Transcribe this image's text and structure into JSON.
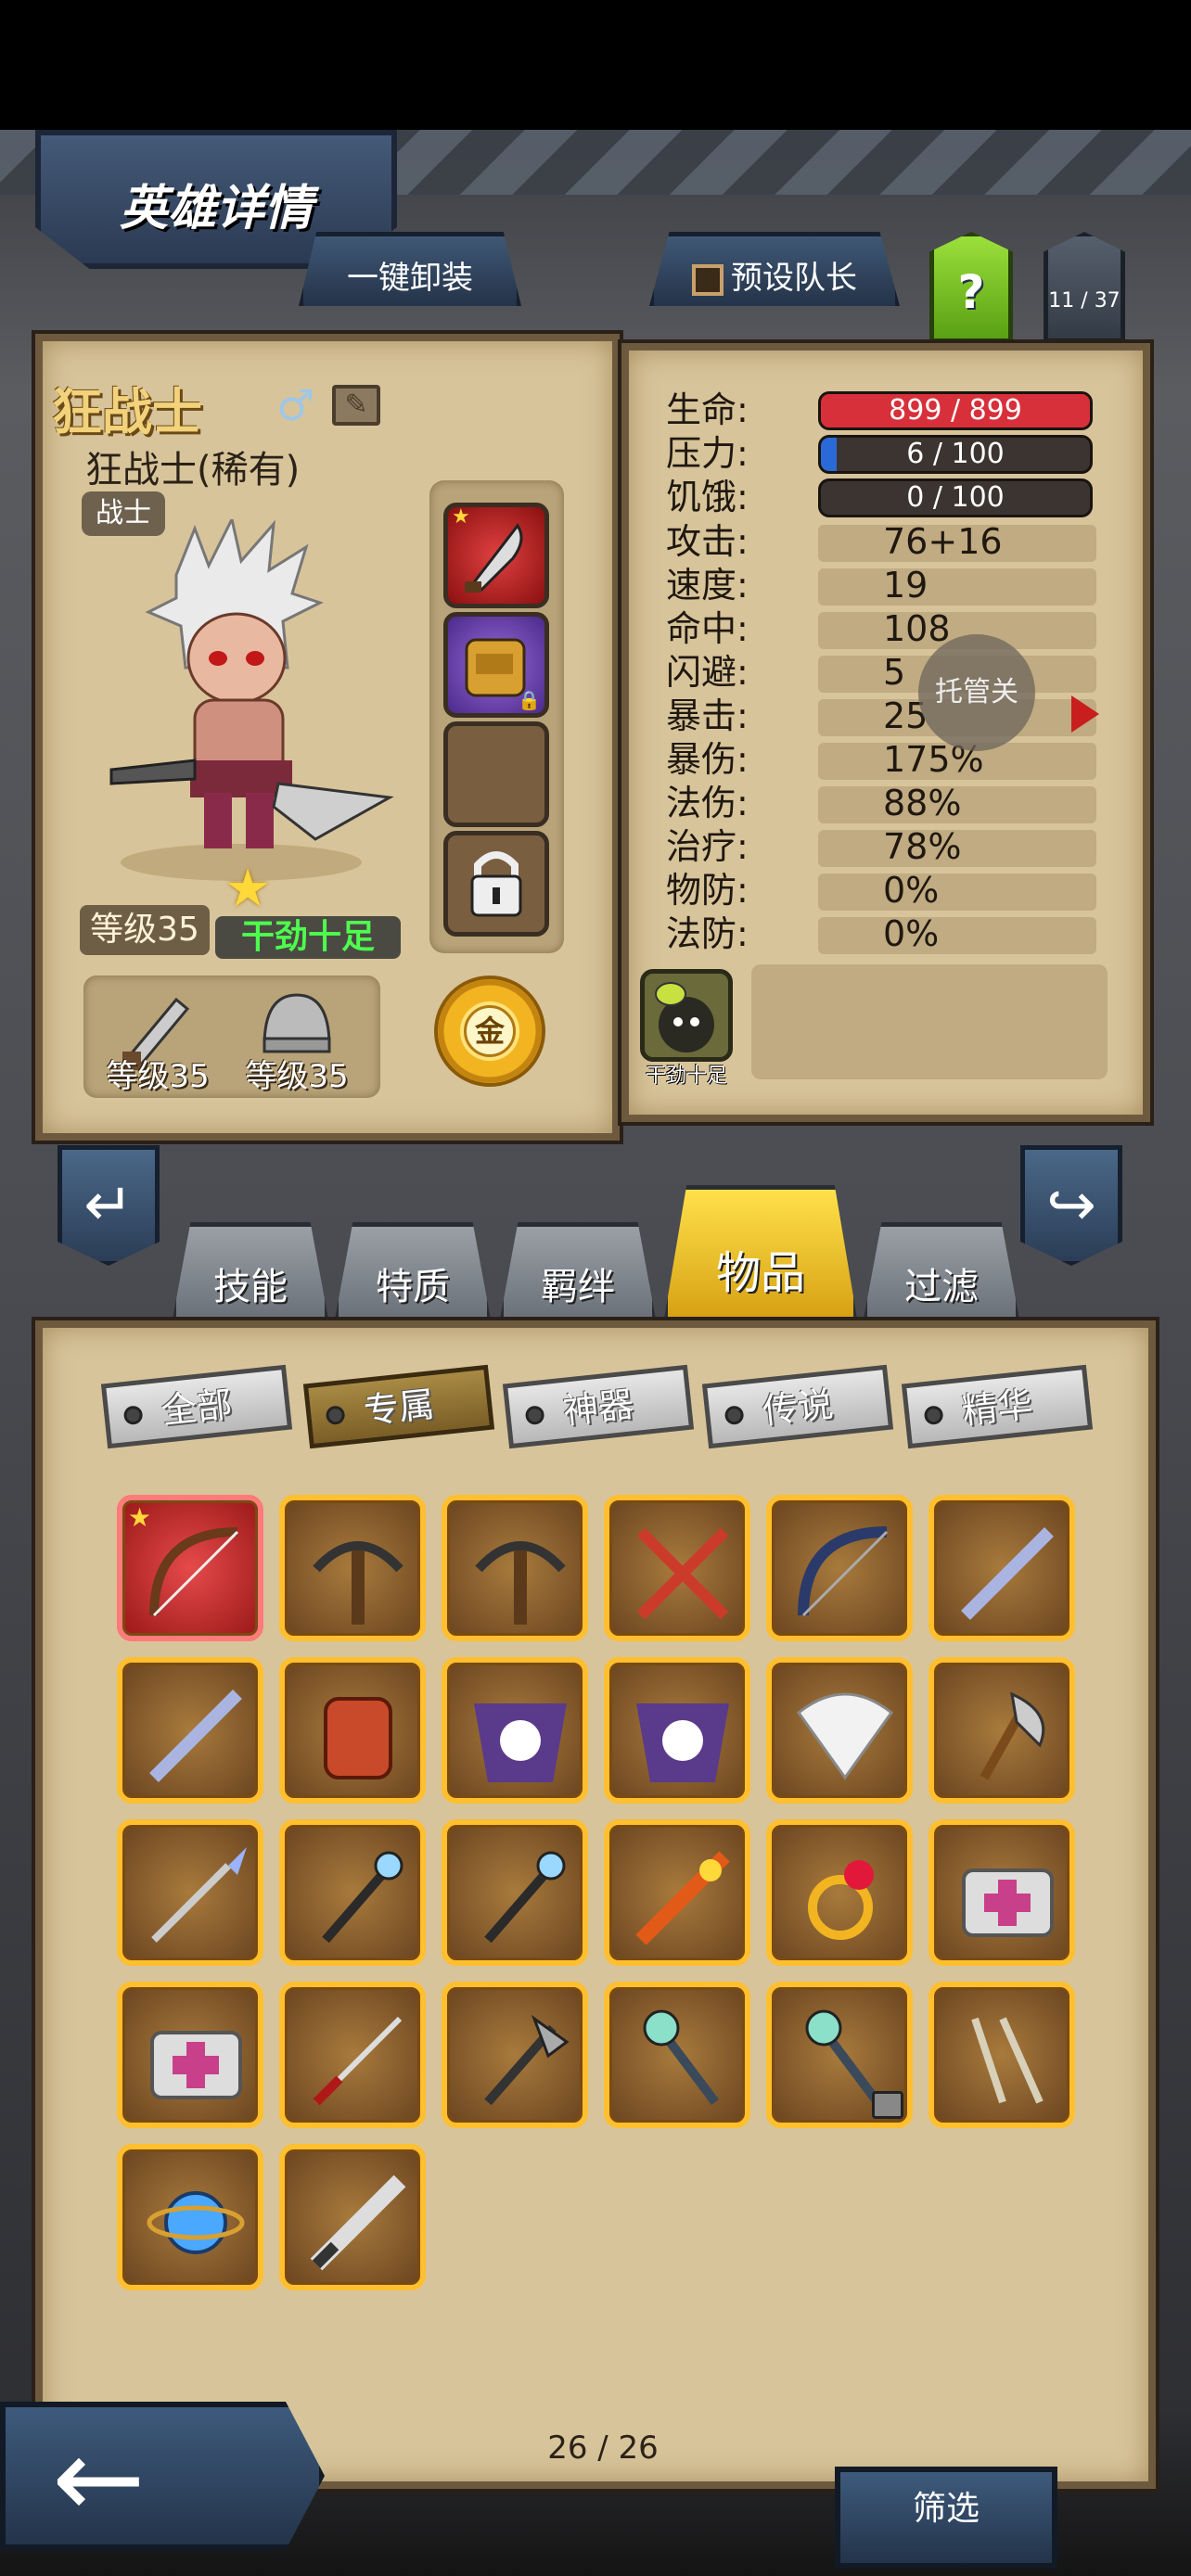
{
  "screen": {
    "title": "英雄详情"
  },
  "top_buttons": {
    "unequip_all": "一键卸装",
    "preset_leader": "预设队长",
    "help": "?",
    "hero_count": "11 / 37"
  },
  "hero": {
    "name": "狂战士",
    "subtitle": "狂战士(稀有)",
    "class": "战士",
    "level": "等级35",
    "trait": "干劲十足",
    "weapon_level": "等级35",
    "armor_level": "等级35",
    "currency": "金"
  },
  "stats": {
    "hp": {
      "label": "生命:",
      "value": "899 / 899",
      "fill": 1.0,
      "color": "#d7303a"
    },
    "stress": {
      "label": "压力:",
      "value": "6 / 100",
      "fill": 0.06,
      "color": "#2a6ad8"
    },
    "hunger": {
      "label": "饥饿:",
      "value": "0 / 100",
      "fill": 0.0,
      "color": "#888888"
    },
    "rows": [
      {
        "label": "攻击:",
        "value": "76+16"
      },
      {
        "label": "速度:",
        "value": "19"
      },
      {
        "label": "命中:",
        "value": "108"
      },
      {
        "label": "闪避:",
        "value": "5"
      },
      {
        "label": "暴击:",
        "value": "25"
      },
      {
        "label": "暴伤:",
        "value": "175%"
      },
      {
        "label": "法伤:",
        "value": "88%"
      },
      {
        "label": "治疗:",
        "value": "78%"
      },
      {
        "label": "物防:",
        "value": "0%"
      },
      {
        "label": "法防:",
        "value": "0%"
      }
    ],
    "auto_toggle": "托管关",
    "trait_slot_label": "干劲十足"
  },
  "tabs": [
    "技能",
    "特质",
    "羁绊",
    "物品",
    "过滤"
  ],
  "active_tab": "物品",
  "filters": [
    "全部",
    "专属",
    "神器",
    "传说",
    "精华"
  ],
  "active_filter": "专属",
  "items": [
    "bow",
    "crossbow",
    "crossbow",
    "twin-daggers",
    "dark-bow",
    "flute",
    "flute",
    "armor",
    "skull-cloak",
    "skull-cloak",
    "feather-fan",
    "axe",
    "spear",
    "staff",
    "staff",
    "flame-sword",
    "ruby-ring",
    "medkit",
    "medkit",
    "katana",
    "battle-axe",
    "gem-staff",
    "gem-staff",
    "claw-blades",
    "orb",
    "drill-lance"
  ],
  "pagination": "26 / 26",
  "bottom": {
    "filter_button": "筛选"
  }
}
